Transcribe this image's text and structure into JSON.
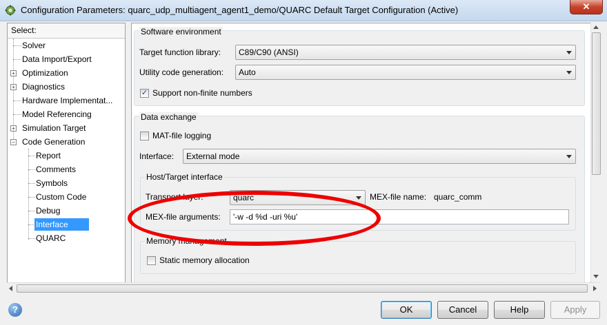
{
  "window": {
    "title": "Configuration Parameters: quarc_udp_multiagent_agent1_demo/QUARC Default Target Configuration (Active)",
    "close_glyph": "✕"
  },
  "tree": {
    "header": "Select:",
    "items": [
      {
        "label": "Solver"
      },
      {
        "label": "Data Import/Export"
      },
      {
        "label": "Optimization"
      },
      {
        "label": "Diagnostics"
      },
      {
        "label": "Hardware Implementat..."
      },
      {
        "label": "Model Referencing"
      },
      {
        "label": "Simulation Target"
      },
      {
        "label": "Code Generation"
      },
      {
        "label": "Report"
      },
      {
        "label": "Comments"
      },
      {
        "label": "Symbols"
      },
      {
        "label": "Custom Code"
      },
      {
        "label": "Debug"
      },
      {
        "label": "Interface",
        "selected": true
      },
      {
        "label": "QUARC"
      }
    ]
  },
  "software_env": {
    "title": "Software environment",
    "target_fn_label": "Target function library:",
    "target_fn_value": "C89/C90 (ANSI)",
    "utility_label": "Utility code generation:",
    "utility_value": "Auto",
    "nonfinite_label": "Support non-finite numbers",
    "nonfinite_checked": true
  },
  "data_exchange": {
    "title": "Data exchange",
    "mat_label": "MAT-file logging",
    "mat_checked": false,
    "interface_label": "Interface:",
    "interface_value": "External mode",
    "host_target": {
      "title": "Host/Target interface",
      "transport_label": "Transport layer:",
      "transport_value": "quarc",
      "mex_name_label": "MEX-file name:",
      "mex_name_value": "quarc_comm",
      "mex_args_label": "MEX-file arguments:",
      "mex_args_value": "'-w -d %d -uri %u'"
    },
    "memory": {
      "title": "Memory management",
      "static_label": "Static memory allocation",
      "static_checked": false
    }
  },
  "buttons": {
    "ok": "OK",
    "cancel": "Cancel",
    "help": "Help",
    "apply": "Apply"
  },
  "colors": {
    "selection": "#3399ff",
    "annotation_ellipse": "#ee0000"
  }
}
